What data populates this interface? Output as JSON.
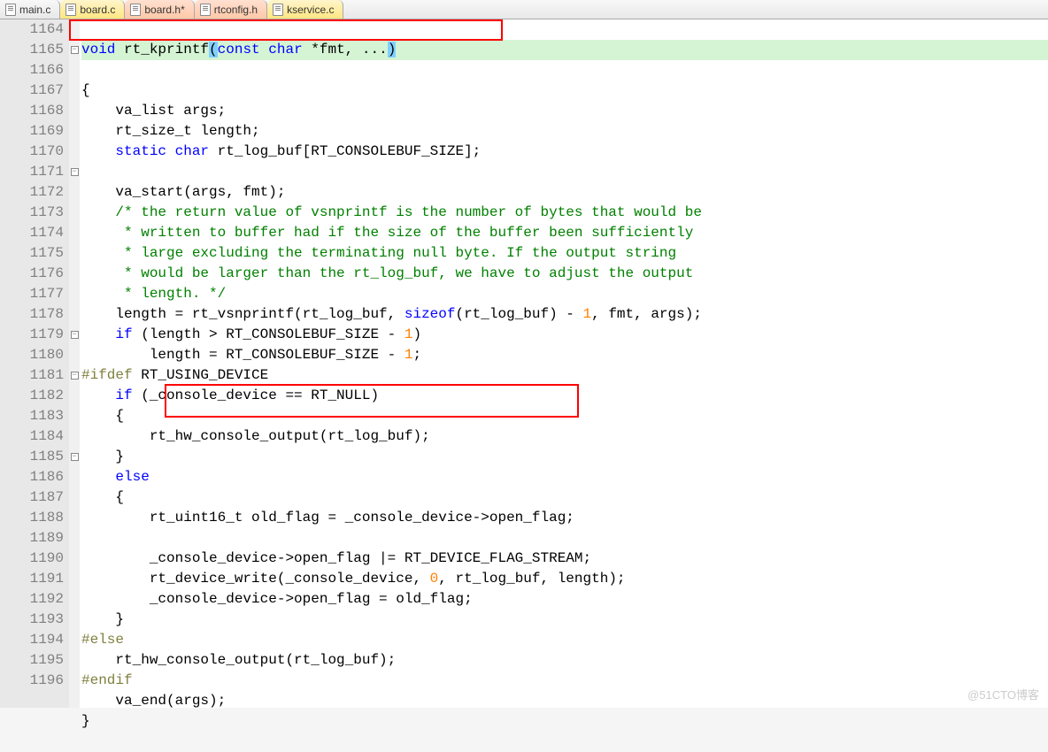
{
  "tabs": [
    {
      "label": "main.c",
      "state": "normal"
    },
    {
      "label": "board.c",
      "state": "active"
    },
    {
      "label": "board.h*",
      "state": "modified"
    },
    {
      "label": "rtconfig.h",
      "state": "modified"
    },
    {
      "label": "kservice.c",
      "state": "active"
    }
  ],
  "lines": {
    "1164": "1164",
    "1165": "1165",
    "1166": "1166",
    "1167": "1167",
    "1168": "1168",
    "1169": "1169",
    "1170": "1170",
    "1171": "1171",
    "1172": "1172",
    "1173": "1173",
    "1174": "1174",
    "1175": "1175",
    "1176": "1176",
    "1177": "1177",
    "1178": "1178",
    "1179": "1179",
    "1180": "1180",
    "1181": "1181",
    "1182": "1182",
    "1183": "1183",
    "1184": "1184",
    "1185": "1185",
    "1186": "1186",
    "1187": "1187",
    "1188": "1188",
    "1189": "1189",
    "1190": "1190",
    "1191": "1191",
    "1192": "1192",
    "1193": "1193",
    "1194": "1194",
    "1195": "1195",
    "1196": "1196"
  },
  "code": {
    "l1164_a": "void",
    "l1164_b": " rt_kprintf",
    "l1164_c": "(",
    "l1164_d": "const",
    "l1164_e": " ",
    "l1164_f": "char",
    "l1164_g": " *fmt, ...",
    "l1164_h": ")",
    "l1165": "{",
    "l1166": "    va_list args;",
    "l1167": "    rt_size_t length;",
    "l1168_a": "    ",
    "l1168_b": "static",
    "l1168_c": " ",
    "l1168_d": "char",
    "l1168_e": " rt_log_buf[RT_CONSOLEBUF_SIZE];",
    "l1169": "",
    "l1170": "    va_start(args, fmt);",
    "l1171": "    /* the return value of vsnprintf is the number of bytes that would be",
    "l1172": "     * written to buffer had if the size of the buffer been sufficiently",
    "l1173": "     * large excluding the terminating null byte. If the output string",
    "l1174": "     * would be larger than the rt_log_buf, we have to adjust the output",
    "l1175": "     * length. */",
    "l1176_a": "    length = rt_vsnprintf(rt_log_buf, ",
    "l1176_b": "sizeof",
    "l1176_c": "(rt_log_buf) - ",
    "l1176_d": "1",
    "l1176_e": ", fmt, args);",
    "l1177_a": "    ",
    "l1177_b": "if",
    "l1177_c": " (length > RT_CONSOLEBUF_SIZE - ",
    "l1177_d": "1",
    "l1177_e": ")",
    "l1178_a": "        length = RT_CONSOLEBUF_SIZE - ",
    "l1178_b": "1",
    "l1178_c": ";",
    "l1179_a": "#ifdef",
    "l1179_b": " RT_USING_DEVICE",
    "l1180_a": "    ",
    "l1180_b": "if",
    "l1180_c": " (_console_device == RT_NULL)",
    "l1181": "    {",
    "l1182": "        rt_hw_console_output(rt_log_buf);",
    "l1183": "    }",
    "l1184_a": "    ",
    "l1184_b": "else",
    "l1185": "    {",
    "l1186": "        rt_uint16_t old_flag = _console_device->open_flag;",
    "l1187": "",
    "l1188": "        _console_device->open_flag |= RT_DEVICE_FLAG_STREAM;",
    "l1189_a": "        rt_device_write(_console_device, ",
    "l1189_b": "0",
    "l1189_c": ", rt_log_buf, length);",
    "l1190": "        _console_device->open_flag = old_flag;",
    "l1191": "    }",
    "l1192": "#else",
    "l1193": "    rt_hw_console_output(rt_log_buf);",
    "l1194": "#endif",
    "l1195": "    va_end(args);",
    "l1196": "}"
  },
  "fold": {
    "minus": "−"
  },
  "watermark": "@51CTO博客"
}
